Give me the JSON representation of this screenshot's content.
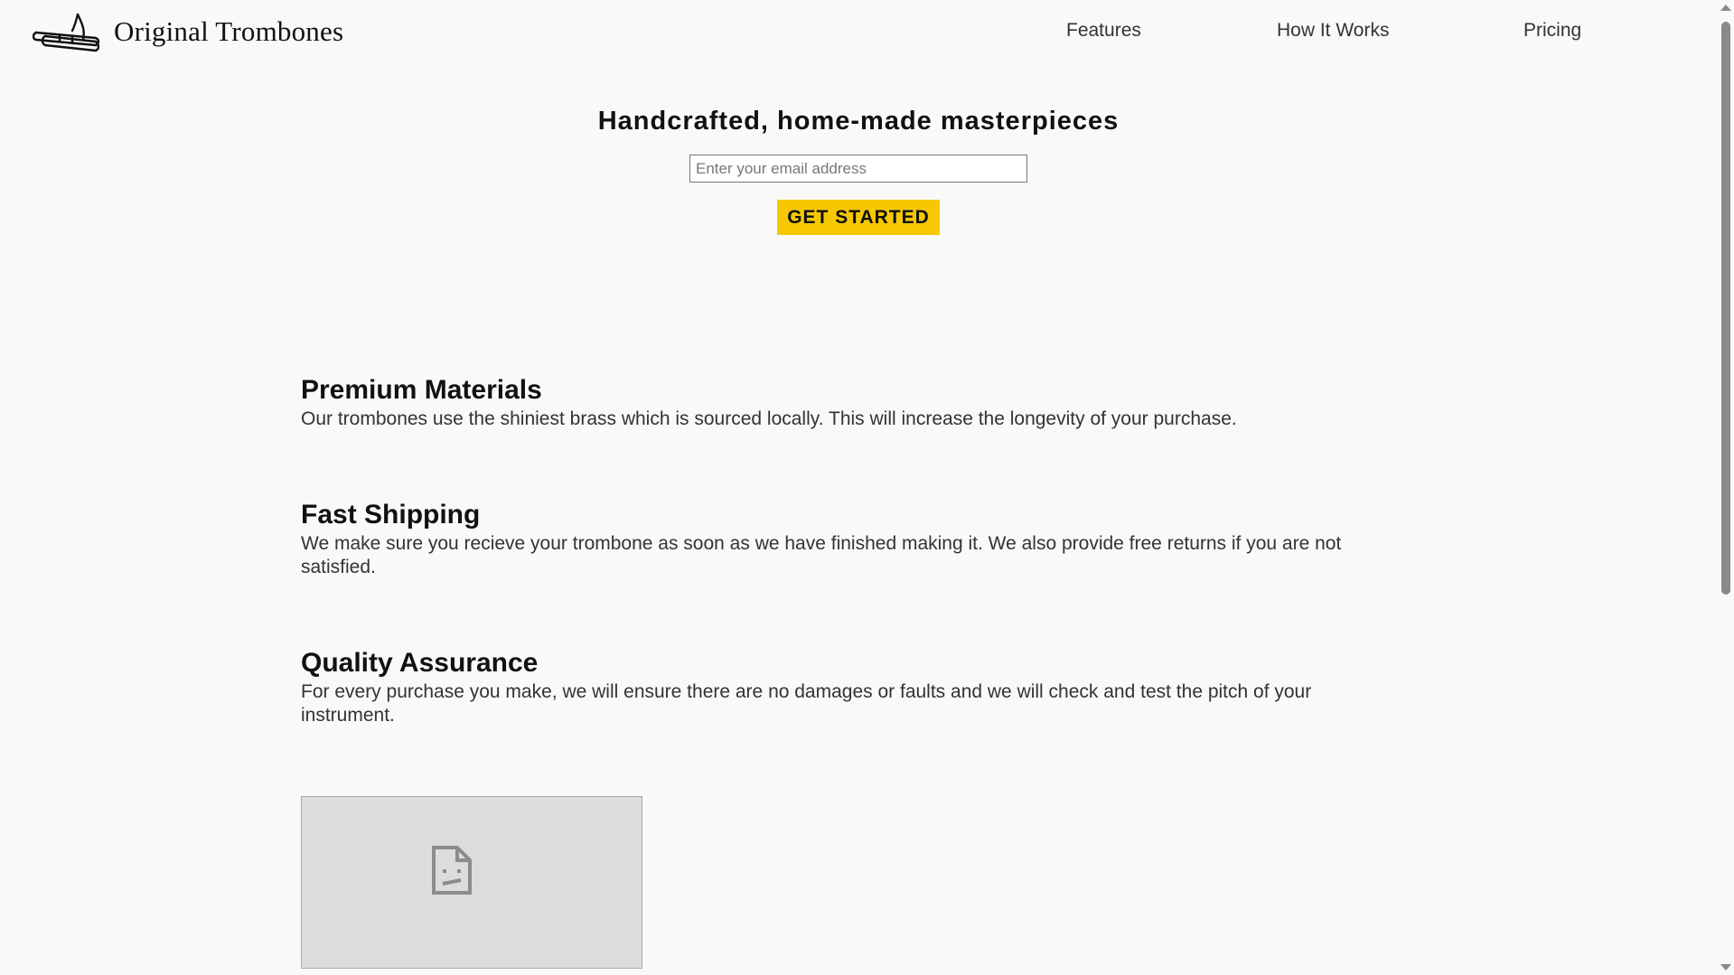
{
  "header": {
    "brand": "Original Trombones",
    "logo_icon": "trombone-icon",
    "nav": [
      {
        "label": "Features"
      },
      {
        "label": "How It Works"
      },
      {
        "label": "Pricing"
      }
    ]
  },
  "hero": {
    "title": "Handcrafted, home-made masterpieces",
    "email_placeholder": "Enter your email address",
    "email_value": "",
    "cta_label": "GET STARTED"
  },
  "features": [
    {
      "title": "Premium Materials",
      "text": "Our trombones use the shiniest brass which is sourced locally. This will increase the longevity of your purchase."
    },
    {
      "title": "Fast Shipping",
      "text": "We make sure you recieve your trombone as soon as we have finished making it. We also provide free returns if you are not satisfied."
    },
    {
      "title": "Quality Assurance",
      "text": "For every purchase you make, we will ensure there are no damages or faults and we will check and test the pitch of your instrument."
    }
  ],
  "media": {
    "icon": "broken-image-icon"
  },
  "colors": {
    "background": "#f9f9f7",
    "accent": "#f5c800",
    "text": "#111111",
    "placeholder_bg": "#dcdcdc"
  }
}
